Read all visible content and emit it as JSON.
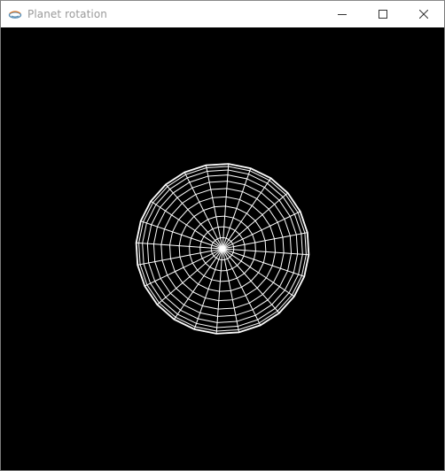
{
  "window": {
    "title": "Planet rotation",
    "app_icon": "java-cup-icon",
    "controls": {
      "minimize_icon": "minimize-icon",
      "maximize_icon": "maximize-icon",
      "close_icon": "close-icon"
    }
  },
  "scene": {
    "background": "#000000",
    "line_color": "#ffffff",
    "object": "wireframe-sphere"
  }
}
